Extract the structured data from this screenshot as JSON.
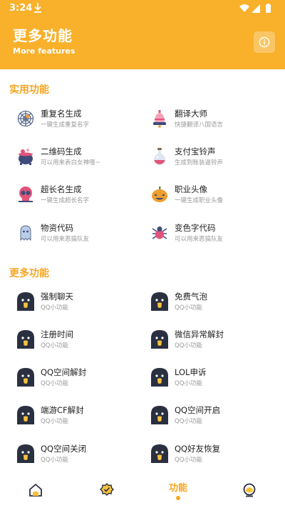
{
  "status": {
    "time": "3:24"
  },
  "header": {
    "title": "更多功能",
    "subtitle": "More features"
  },
  "sections": [
    {
      "title": "实用功能",
      "items": [
        {
          "title": "重复名生成",
          "sub": "一键生成重复名字",
          "icon": "spider-web-icon"
        },
        {
          "title": "翻译大师",
          "sub": "快捷翻译八国语言",
          "icon": "bell-icon"
        },
        {
          "title": "二维码生成",
          "sub": "可以用来表白女神哦~",
          "icon": "cauldron-icon"
        },
        {
          "title": "支付宝铃声",
          "sub": "生成到账装逼铃声",
          "icon": "potion-icon"
        },
        {
          "title": "超长名生成",
          "sub": "一键生成超长名字",
          "icon": "skull-icon"
        },
        {
          "title": "职业头像",
          "sub": "一键生成职业头像",
          "icon": "pumpkin-icon"
        },
        {
          "title": "物资代码",
          "sub": "可以用来恶搞队友",
          "icon": "ghost-icon"
        },
        {
          "title": "变色字代码",
          "sub": "可以用来恶搞队友",
          "icon": "spider-icon"
        }
      ]
    },
    {
      "title": "更多功能",
      "items": [
        {
          "title": "强制聊天",
          "sub": "QQ小功能",
          "icon": "qq-penguin-icon"
        },
        {
          "title": "免费气泡",
          "sub": "QQ小功能",
          "icon": "qq-penguin-icon"
        },
        {
          "title": "注册时间",
          "sub": "QQ小功能",
          "icon": "qq-penguin-icon"
        },
        {
          "title": "微信异常解封",
          "sub": "QQ小功能",
          "icon": "qq-penguin-icon"
        },
        {
          "title": "QQ空间解封",
          "sub": "QQ小功能",
          "icon": "qq-penguin-icon"
        },
        {
          "title": "LOL申诉",
          "sub": "QQ小功能",
          "icon": "qq-penguin-icon"
        },
        {
          "title": "端游CF解封",
          "sub": "QQ小功能",
          "icon": "qq-penguin-icon"
        },
        {
          "title": "QQ空间开启",
          "sub": "QQ小功能",
          "icon": "qq-penguin-icon"
        },
        {
          "title": "QQ空间关闭",
          "sub": "QQ小功能",
          "icon": "qq-penguin-icon"
        },
        {
          "title": "QQ好友恢复",
          "sub": "QQ小功能",
          "icon": "qq-penguin-icon"
        }
      ]
    }
  ],
  "tabs": [
    {
      "icon": "home-icon",
      "label": ""
    },
    {
      "icon": "badge-check-icon",
      "label": ""
    },
    {
      "icon": "",
      "label": "功能",
      "active": true
    },
    {
      "icon": "profile-icon",
      "label": ""
    }
  ],
  "colors": {
    "accent": "#f9b02a",
    "accent_text": "#f5a623",
    "penguin": "#2b3040"
  }
}
